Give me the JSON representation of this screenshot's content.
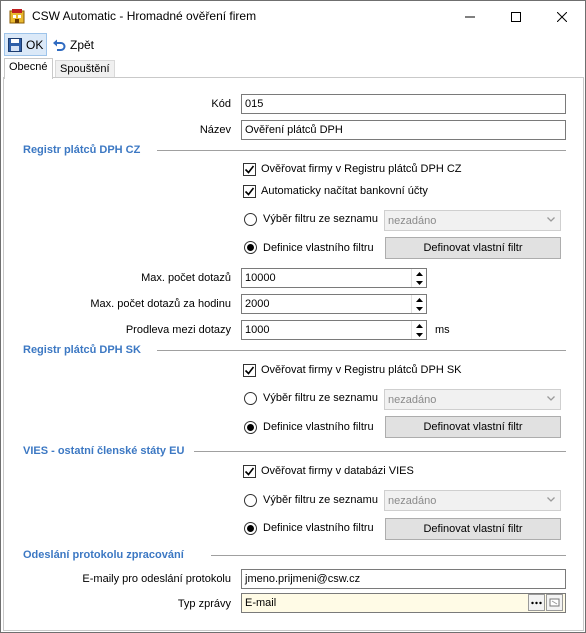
{
  "window": {
    "title": "CSW Automatic - Hromadné ověření firem"
  },
  "toolbar": {
    "ok_label": "OK",
    "back_label": "Zpět"
  },
  "tabs": [
    {
      "label": "Obecné"
    },
    {
      "label": "Spouštění"
    }
  ],
  "general": {
    "kod_label": "Kód",
    "kod_value": "015",
    "nazev_label": "Název",
    "nazev_value": "Ověření plátců DPH"
  },
  "cz": {
    "header": "Registr plátců DPH CZ",
    "verify_label": "Ověřovat firmy v Registru plátců DPH CZ",
    "bank_label": "Automaticky načítat bankovní účty",
    "filter_list_label": "Výběr filtru ze seznamu",
    "filter_value": "nezadáno",
    "custom_filter_label": "Definice vlastního filtru",
    "define_filter_button": "Definovat vlastní filtr",
    "max_queries_label": "Max. počet dotazů",
    "max_queries_value": "10000",
    "max_per_hour_label": "Max. počet dotazů za hodinu",
    "max_per_hour_value": "2000",
    "delay_label": "Prodleva mezi dotazy",
    "delay_value": "1000",
    "delay_unit": "ms"
  },
  "sk": {
    "header": "Registr plátců DPH SK",
    "verify_label": "Ověřovat firmy v Registru plátců DPH SK",
    "filter_list_label": "Výběr filtru ze seznamu",
    "filter_value": "nezadáno",
    "custom_filter_label": "Definice vlastního filtru",
    "define_filter_button": "Definovat vlastní filtr"
  },
  "vies": {
    "header": "VIES - ostatní členské státy EU",
    "verify_label": "Ověřovat firmy v databázi VIES",
    "filter_list_label": "Výběr filtru ze seznamu",
    "filter_value": "nezadáno",
    "custom_filter_label": "Definice vlastního filtru",
    "define_filter_button": "Definovat vlastní filtr"
  },
  "protocol": {
    "header": "Odeslání protokolu zpracování",
    "emails_label": "E-maily pro odeslání protokolu",
    "emails_value": "jmeno.prijmeni@csw.cz",
    "msg_type_label": "Typ zprávy",
    "msg_type_value": "E-mail"
  },
  "colors": {
    "section": "#3c78c3",
    "accent": "#dbe9f8",
    "msg_type_bg": "#fffbe6"
  },
  "icons": [
    "app-icon",
    "minimize-icon",
    "maximize-icon",
    "close-icon",
    "save-icon",
    "undo-icon",
    "chevron-down-icon",
    "ellipsis-icon",
    "clear-icon"
  ]
}
